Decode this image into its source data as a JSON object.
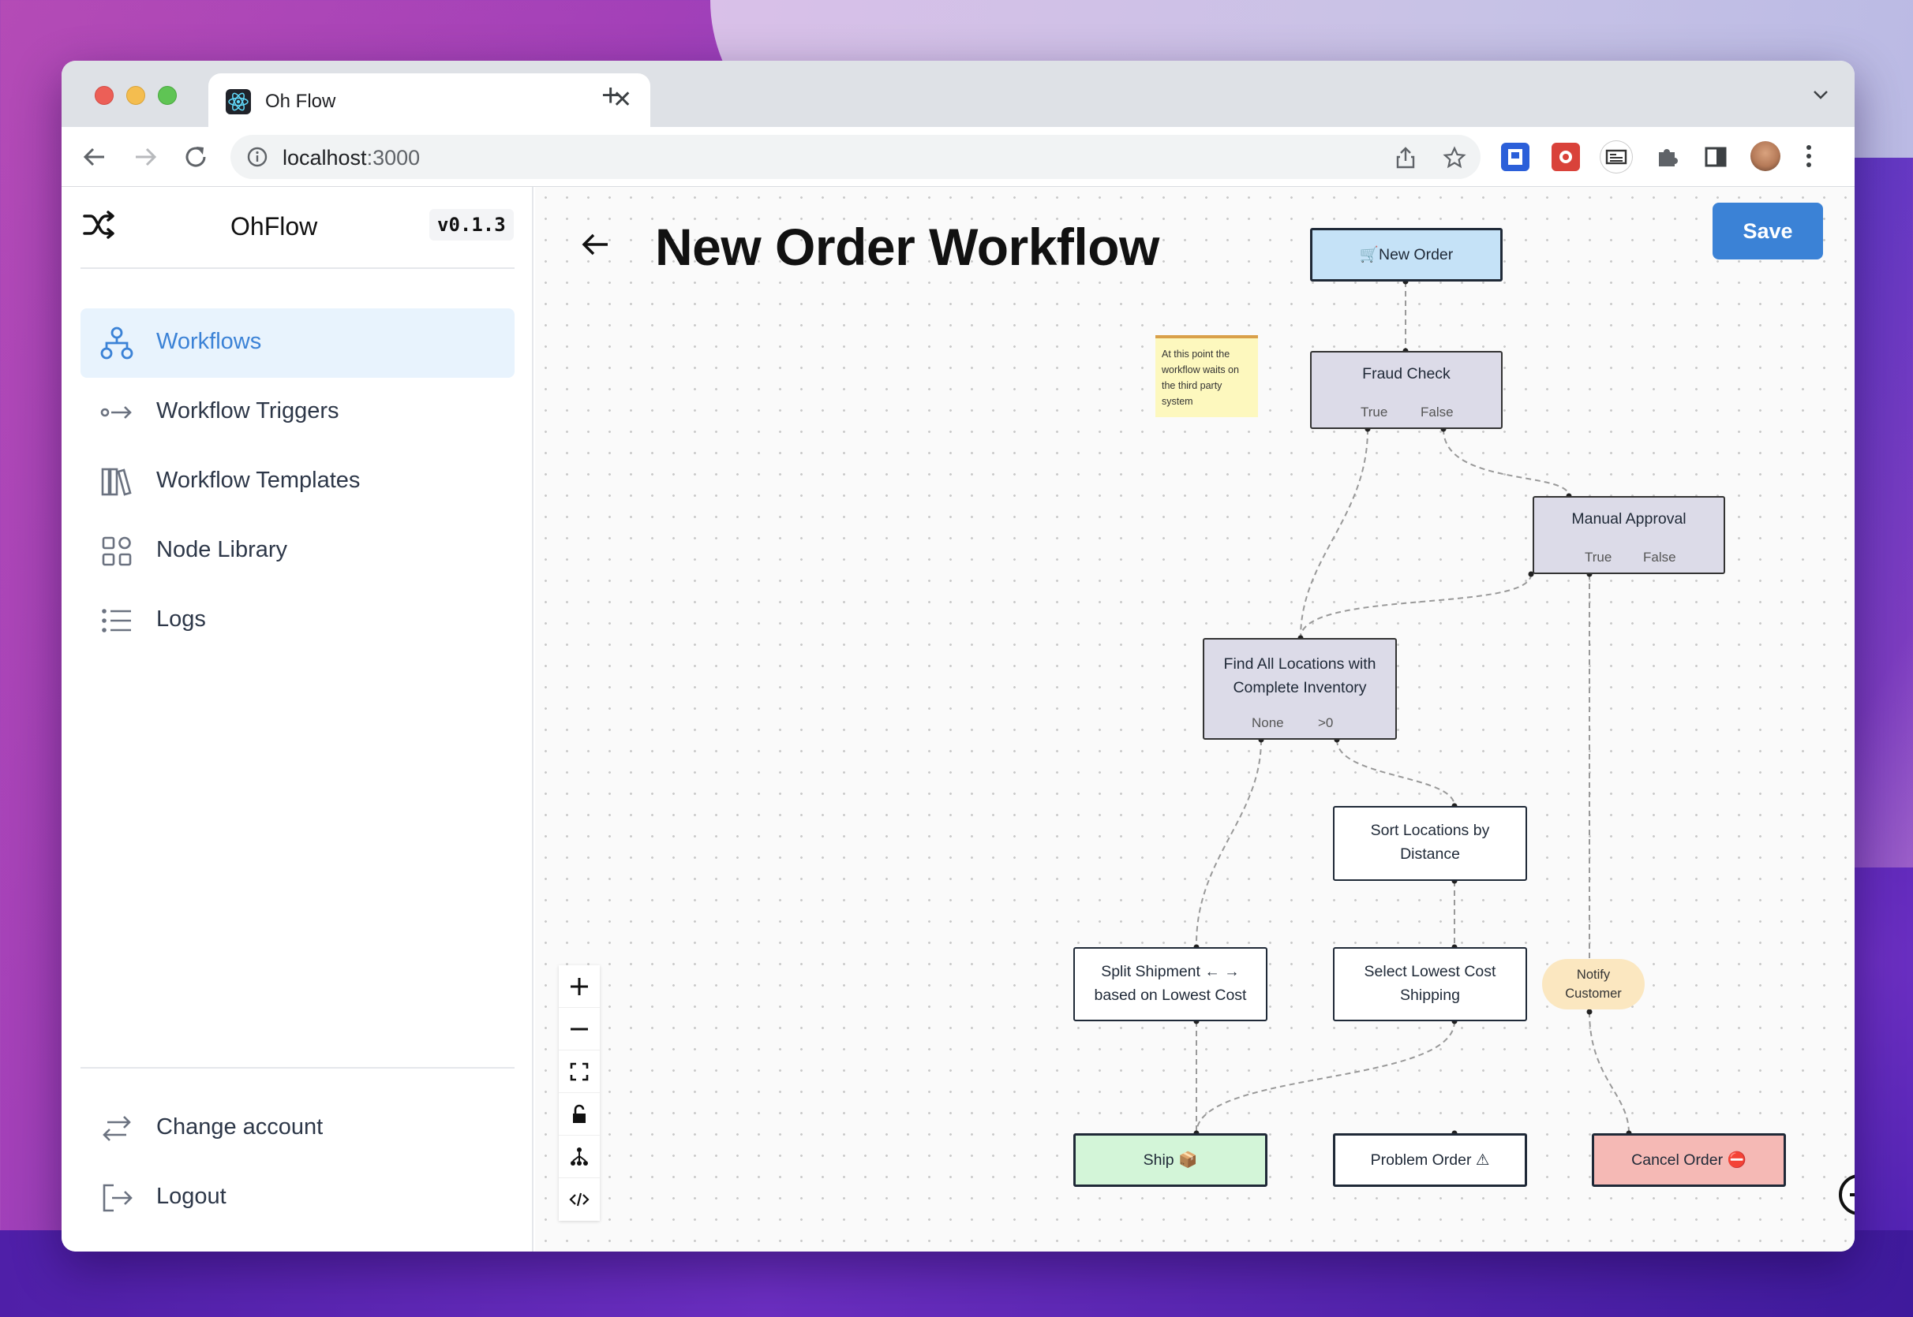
{
  "browser": {
    "tab_title": "Oh Flow",
    "url_host": "localhost",
    "url_port": ":3000"
  },
  "sidebar": {
    "brand": "OhFlow",
    "version": "v0.1.3",
    "items": [
      {
        "label": "Workflows",
        "icon": "workflow-icon",
        "active": true
      },
      {
        "label": "Workflow Triggers",
        "icon": "trigger-icon",
        "active": false
      },
      {
        "label": "Workflow Templates",
        "icon": "templates-icon",
        "active": false
      },
      {
        "label": "Node Library",
        "icon": "grid-icon",
        "active": false
      },
      {
        "label": "Logs",
        "icon": "list-icon",
        "active": false
      }
    ],
    "footer": [
      {
        "label": "Change account",
        "icon": "switch-icon"
      },
      {
        "label": "Logout",
        "icon": "logout-icon"
      }
    ]
  },
  "main": {
    "title": "New Order Workflow",
    "save_label": "Save",
    "sticky_note": "At this point the workflow waits on the third party system",
    "nodes": {
      "new_order": "🛒New Order",
      "fraud_check": "Fraud Check",
      "fraud_true": "True",
      "fraud_false": "False",
      "manual_approval": "Manual Approval",
      "manual_true": "True",
      "manual_false": "False",
      "find_locations_1": "Find All Locations with",
      "find_locations_2": "Complete Inventory",
      "find_none": "None",
      "find_gt0": ">0",
      "sort_1": "Sort Locations by",
      "sort_2": "Distance",
      "split_1": "Split Shipment ← →",
      "split_2": "based on Lowest Cost",
      "select_1": "Select Lowest Cost",
      "select_2": "Shipping",
      "notify_1": "Notify",
      "notify_2": "Customer",
      "ship": "Ship 📦",
      "problem": "Problem Order ⚠",
      "cancel": "Cancel Order ⛔"
    },
    "colors": {
      "accent": "#3b82d6",
      "trigger_node": "#c5e2f7",
      "decision_node": "#dcdbe8",
      "success_node": "#d3f5d8",
      "cancel_node": "#f5b9b5",
      "notify_node": "#fbe7c0",
      "sticky": "#fdf8be"
    }
  }
}
